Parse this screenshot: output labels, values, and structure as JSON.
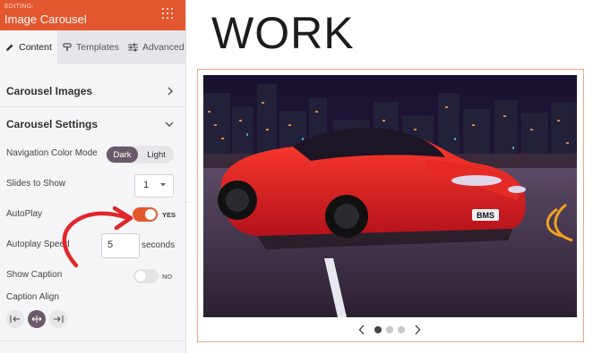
{
  "panel": {
    "editing_label": "EDITING:",
    "title": "Image Carousel",
    "menu_icon": "drag-grid-icon",
    "accent_color": "#e4572e"
  },
  "tabs": [
    {
      "label": "Content",
      "icon": "pencil-icon",
      "active": true
    },
    {
      "label": "Templates",
      "icon": "paintbrush-icon",
      "active": false
    },
    {
      "label": "Advanced",
      "icon": "sliders-icon",
      "active": false
    }
  ],
  "sections": {
    "carousel_images": "Carousel Images",
    "carousel_settings": "Carousel Settings"
  },
  "settings": {
    "nav_color_mode_label": "Navigation Color Mode",
    "nav_color_options": [
      "Dark",
      "Light"
    ],
    "nav_color_selected": "Dark",
    "slides_to_show_label": "Slides to Show",
    "slides_to_show_value": "1",
    "autoplay_label": "AutoPlay",
    "autoplay_state": "YES",
    "autoplay_speed_label": "Autoplay Speed",
    "autoplay_speed_value": "5",
    "autoplay_speed_unit": "seconds",
    "show_caption_label": "Show Caption",
    "show_caption_state": "NO",
    "caption_align_label": "Caption Align",
    "caption_align_selected": "center"
  },
  "canvas": {
    "heading": "WORK",
    "carousel_slide_count": 3,
    "carousel_active_index": 0,
    "license_plate": "BMS"
  }
}
